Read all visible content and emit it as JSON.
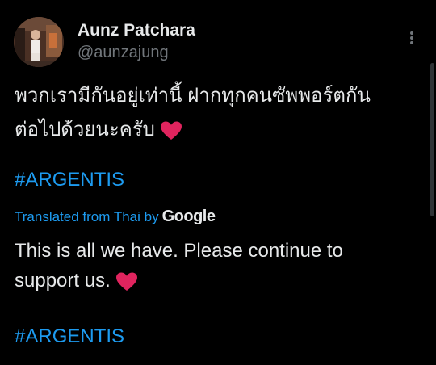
{
  "author": {
    "display_name": "Aunz Patchara",
    "handle": "@aunzajung"
  },
  "tweet": {
    "original_line1": "พวกเรามีกันอยู่เท่านี้ ฝากทุกคนซัพพอร์ตกัน",
    "original_line2": "ต่อไปด้วยนะครับ",
    "hashtag_original": "#ARGENTIS",
    "translated_by_label": "Translated from Thai by",
    "translator": "Google",
    "translation_line1": "This is all we have. Please continue to",
    "translation_line2": "support us.",
    "hashtag_translation": "#ARGENTIS"
  },
  "icons": {
    "more": "more-vertical-icon",
    "heart": "red-heart-emoji"
  },
  "colors": {
    "background": "#000000",
    "text": "#e7e9ea",
    "secondary": "#71767b",
    "link": "#1d9bf0",
    "heart": "#e0245e"
  }
}
